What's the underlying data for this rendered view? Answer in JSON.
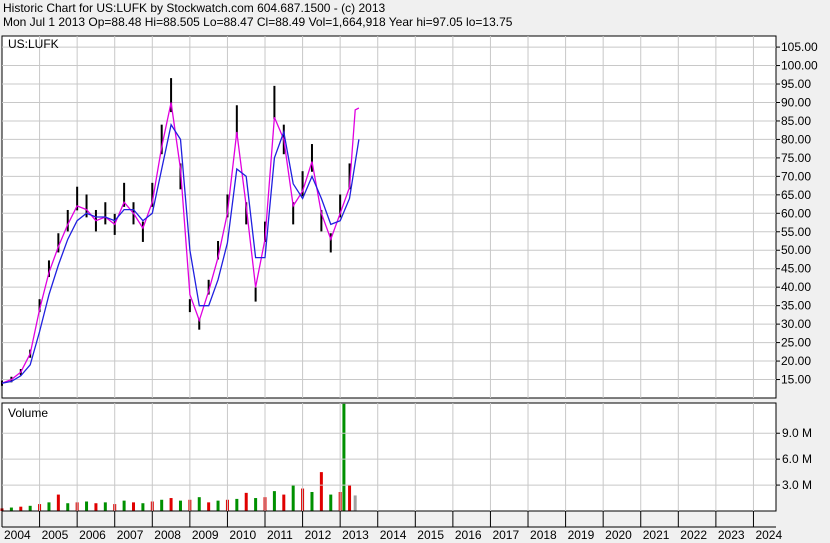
{
  "header": {
    "line1": "Historic Chart for US:LUFK by Stockwatch.com 604.687.1500 - (c) 2013",
    "line2": "Mon Jul  1 2013   Op=88.48   Hi=88.505   Lo=88.47   Cl=88.49   Vol=1,664,918   Year hi=97.05   lo=13.75"
  },
  "colors": {
    "background": "#f0f0f0",
    "plot_bg": "#ffffff",
    "grid": "#c8c8c8",
    "price_bars": "#000000",
    "ma_short": "#e000e0",
    "ma_long": "#2020e0",
    "volume_up": "#009000",
    "volume_down": "#e00000",
    "volume_flat": "#a0a0a0"
  },
  "chart_data": [
    {
      "type": "line",
      "label": "US:LUFK",
      "ylabel_ticks": [
        "105.00",
        "100.00",
        "95.00",
        "90.00",
        "85.00",
        "80.00",
        "75.00",
        "70.00",
        "65.00",
        "60.00",
        "55.00",
        "50.00",
        "45.00",
        "40.00",
        "35.00",
        "30.00",
        "25.00",
        "20.00",
        "15.00"
      ],
      "ylim": [
        10,
        108
      ],
      "grid": true,
      "series": [
        {
          "style": "price-bars",
          "x": [
            2004.0,
            2004.25,
            2004.5,
            2004.75,
            2005.0,
            2005.25,
            2005.5,
            2005.75,
            2006.0,
            2006.25,
            2006.5,
            2006.75,
            2007.0,
            2007.25,
            2007.5,
            2007.75,
            2008.0,
            2008.25,
            2008.5,
            2008.75,
            2009.0,
            2009.25,
            2009.5,
            2009.75,
            2010.0,
            2010.25,
            2010.5,
            2010.75,
            2011.0,
            2011.25,
            2011.5,
            2011.75,
            2012.0,
            2012.25,
            2012.5,
            2012.75,
            2013.0,
            2013.25
          ],
          "values": [
            14,
            15,
            17,
            22,
            35,
            45,
            52,
            58,
            64,
            62,
            58,
            60,
            57,
            65,
            60,
            55,
            65,
            80,
            92,
            70,
            35,
            30,
            40,
            50,
            62,
            85,
            60,
            38,
            55,
            90,
            80,
            60,
            68,
            75,
            58,
            52,
            62,
            70
          ]
        },
        {
          "name": "",
          "style": "ma-short",
          "x": [
            2004.0,
            2004.25,
            2004.5,
            2004.75,
            2005.0,
            2005.25,
            2005.5,
            2005.75,
            2006.0,
            2006.25,
            2006.5,
            2006.75,
            2007.0,
            2007.25,
            2007.5,
            2007.75,
            2008.0,
            2008.25,
            2008.5,
            2008.75,
            2009.0,
            2009.25,
            2009.5,
            2009.75,
            2010.0,
            2010.25,
            2010.5,
            2010.75,
            2011.0,
            2011.25,
            2011.5,
            2011.75,
            2012.0,
            2012.25,
            2012.5,
            2012.75,
            2013.0,
            2013.25,
            2013.4,
            2013.5
          ],
          "values": [
            14,
            15,
            17,
            22,
            34,
            44,
            51,
            57,
            62,
            61,
            58,
            59,
            57,
            63,
            60,
            56,
            63,
            78,
            90,
            72,
            38,
            31,
            39,
            48,
            60,
            82,
            62,
            40,
            53,
            86,
            80,
            62,
            66,
            74,
            60,
            53,
            60,
            67,
            88,
            88.5
          ]
        },
        {
          "name": "",
          "style": "ma-long",
          "x": [
            2004.0,
            2004.25,
            2004.5,
            2004.75,
            2005.0,
            2005.25,
            2005.5,
            2005.75,
            2006.0,
            2006.25,
            2006.5,
            2006.75,
            2007.0,
            2007.25,
            2007.5,
            2007.75,
            2008.0,
            2008.25,
            2008.5,
            2008.75,
            2009.0,
            2009.25,
            2009.5,
            2009.75,
            2010.0,
            2010.25,
            2010.5,
            2010.75,
            2011.0,
            2011.25,
            2011.5,
            2011.75,
            2012.0,
            2012.25,
            2012.5,
            2012.75,
            2013.0,
            2013.25,
            2013.5
          ],
          "values": [
            14,
            14.5,
            16,
            19,
            28,
            38,
            46,
            53,
            58,
            60,
            59,
            59,
            58,
            61,
            61,
            58,
            60,
            72,
            84,
            80,
            50,
            35,
            35,
            42,
            52,
            72,
            70,
            48,
            48,
            75,
            82,
            68,
            64,
            70,
            64,
            57,
            58,
            64,
            80
          ]
        }
      ]
    },
    {
      "type": "bar",
      "label": "Volume",
      "ylabel_ticks": [
        "9.0 M",
        "6.0 M",
        "3.0 M"
      ],
      "ylim": [
        0,
        12.5
      ],
      "unit": "M",
      "series": [
        {
          "name": "",
          "x": [
            2004.0,
            2004.25,
            2004.5,
            2004.75,
            2005.0,
            2005.25,
            2005.5,
            2005.75,
            2006.0,
            2006.25,
            2006.5,
            2006.75,
            2007.0,
            2007.25,
            2007.5,
            2007.75,
            2008.0,
            2008.25,
            2008.5,
            2008.75,
            2009.0,
            2009.25,
            2009.5,
            2009.75,
            2010.0,
            2010.25,
            2010.5,
            2010.75,
            2011.0,
            2011.25,
            2011.5,
            2011.75,
            2012.0,
            2012.25,
            2012.5,
            2012.75,
            2013.0,
            2013.1,
            2013.25,
            2013.4
          ],
          "values": [
            0.3,
            0.4,
            0.5,
            0.6,
            0.8,
            1.0,
            1.9,
            0.9,
            1.0,
            1.1,
            0.9,
            1.0,
            0.8,
            1.2,
            1.0,
            0.9,
            1.1,
            1.3,
            1.5,
            1.2,
            1.3,
            1.6,
            1.0,
            1.2,
            1.3,
            1.4,
            2.1,
            1.5,
            1.6,
            2.3,
            1.9,
            3.0,
            2.6,
            2.2,
            4.5,
            1.9,
            2.2,
            12.4,
            3.0,
            1.8
          ],
          "direction": [
            "down",
            "up",
            "down",
            "up",
            "down",
            "up",
            "down",
            "up",
            "down",
            "up",
            "down",
            "up",
            "down",
            "up",
            "down",
            "up",
            "down",
            "up",
            "down",
            "up",
            "down",
            "up",
            "down",
            "up",
            "down",
            "up",
            "down",
            "up",
            "down",
            "up",
            "down",
            "up",
            "down",
            "up",
            "down",
            "up",
            "down",
            "up",
            "down",
            "flat"
          ]
        }
      ]
    },
    {
      "type": "table",
      "label": "time-axis",
      "xlabel_ticks": [
        "2004",
        "2005",
        "2006",
        "2007",
        "2008",
        "2009",
        "2010",
        "2011",
        "2012",
        "2013",
        "2014",
        "2015",
        "2016",
        "2017",
        "2018",
        "2019",
        "2020",
        "2021",
        "2022",
        "2023",
        "2024"
      ]
    }
  ]
}
